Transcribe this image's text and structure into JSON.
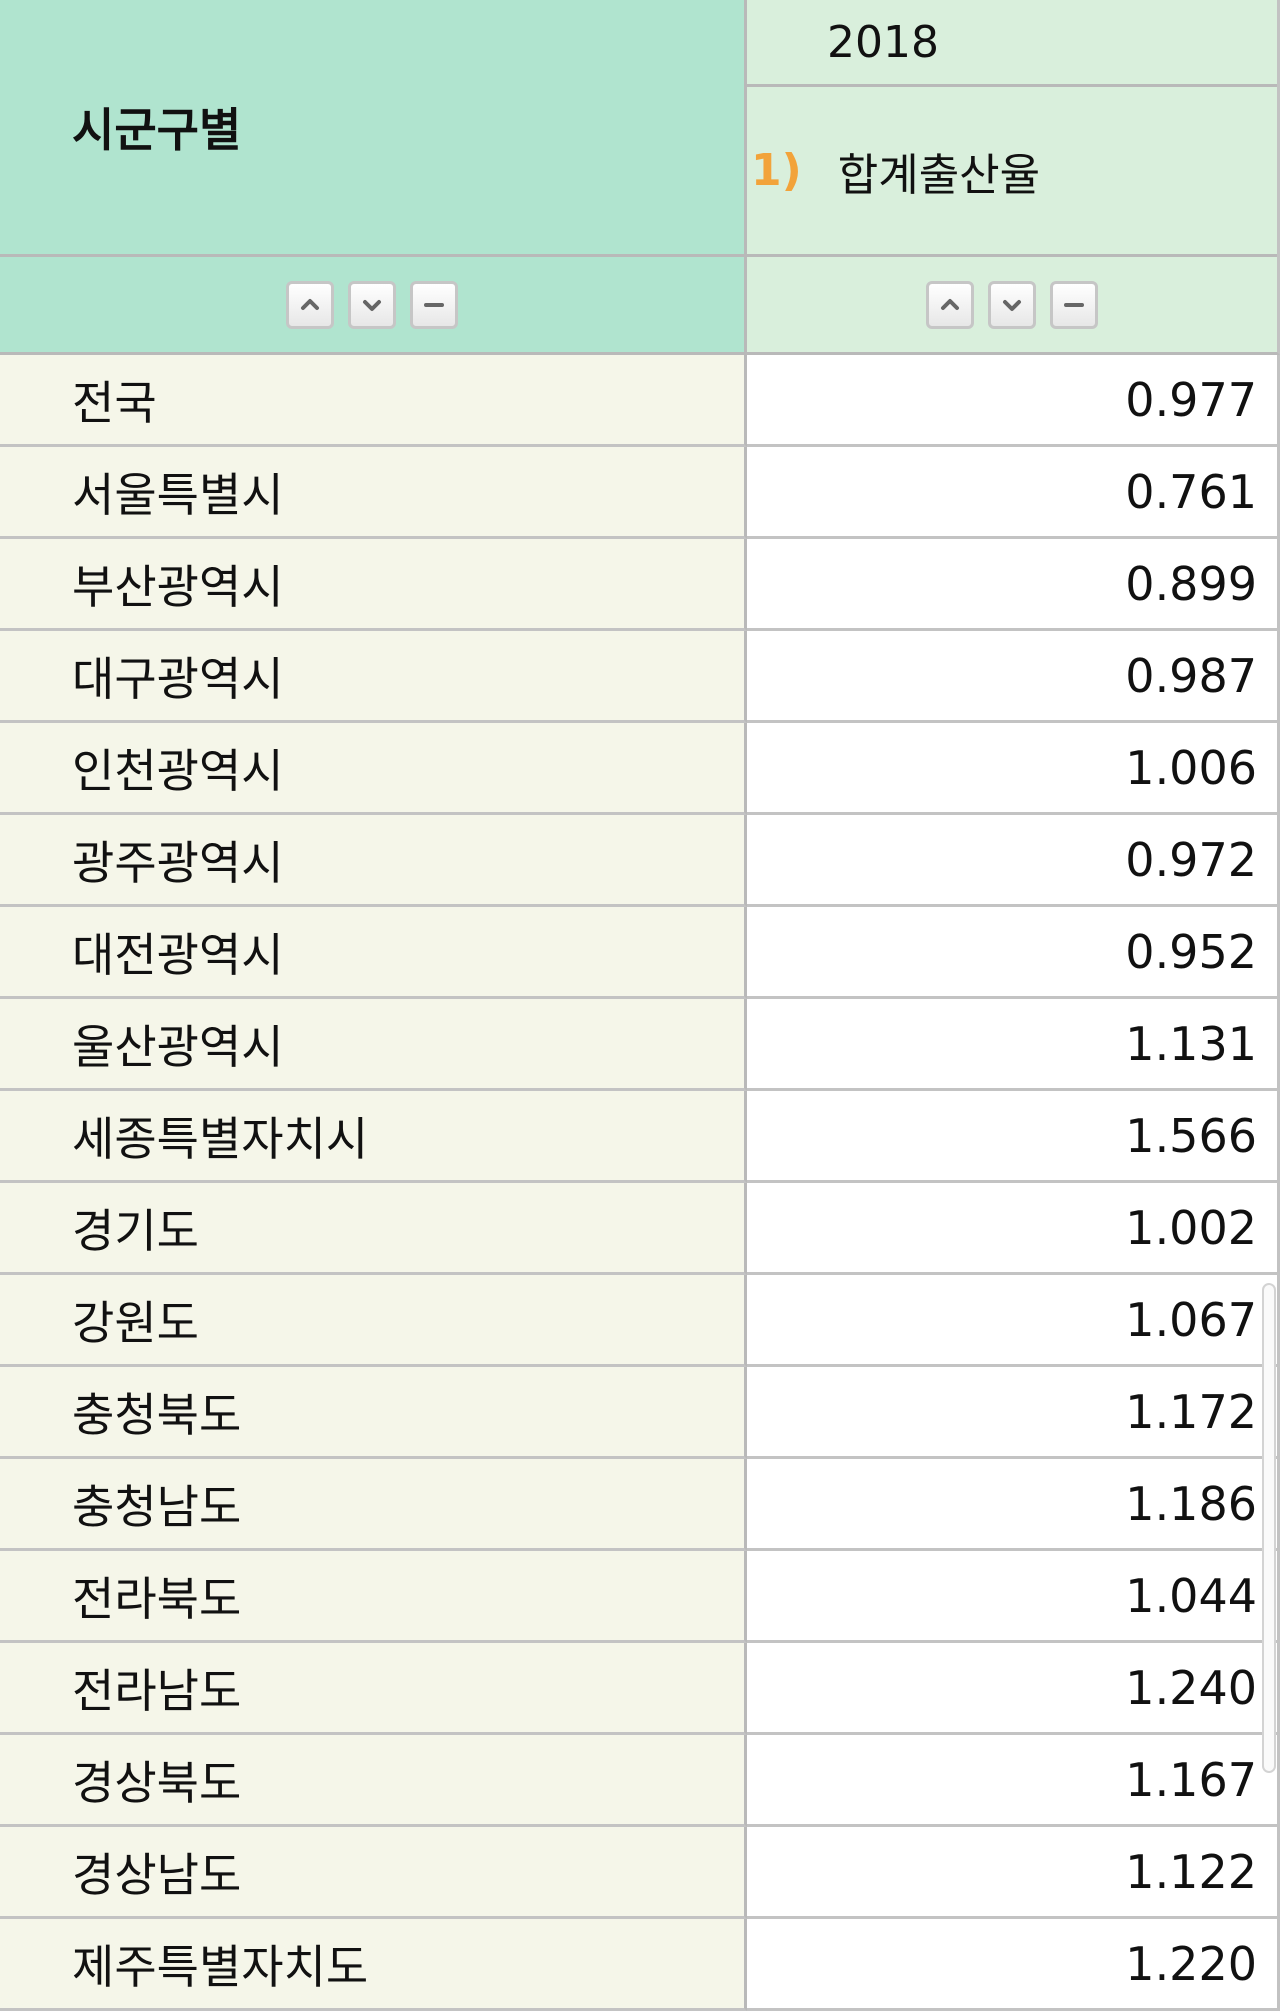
{
  "header": {
    "region_label": "시군구별",
    "year": "2018",
    "footnote": "1)",
    "measure_label": "합계출산율"
  },
  "sort_controls": {
    "icons": [
      "sort-ascending-icon",
      "sort-descending-icon",
      "remove-column-icon"
    ]
  },
  "rows": [
    {
      "region": "전국",
      "value": "0.977"
    },
    {
      "region": "서울특별시",
      "value": "0.761"
    },
    {
      "region": "부산광역시",
      "value": "0.899"
    },
    {
      "region": "대구광역시",
      "value": "0.987"
    },
    {
      "region": "인천광역시",
      "value": "1.006"
    },
    {
      "region": "광주광역시",
      "value": "0.972"
    },
    {
      "region": "대전광역시",
      "value": "0.952"
    },
    {
      "region": "울산광역시",
      "value": "1.131"
    },
    {
      "region": "세종특별자치시",
      "value": "1.566"
    },
    {
      "region": "경기도",
      "value": "1.002"
    },
    {
      "region": "강원도",
      "value": "1.067"
    },
    {
      "region": "충청북도",
      "value": "1.172"
    },
    {
      "region": "충청남도",
      "value": "1.186"
    },
    {
      "region": "전라북도",
      "value": "1.044"
    },
    {
      "region": "전라남도",
      "value": "1.240"
    },
    {
      "region": "경상북도",
      "value": "1.167"
    },
    {
      "region": "경상남도",
      "value": "1.122"
    },
    {
      "region": "제주특별자치도",
      "value": "1.220"
    }
  ],
  "colors": {
    "header_left": "#b0e4cf",
    "header_right": "#d9efdc",
    "row_label_bg": "#f5f6e9",
    "footnote": "#f2a33a"
  }
}
